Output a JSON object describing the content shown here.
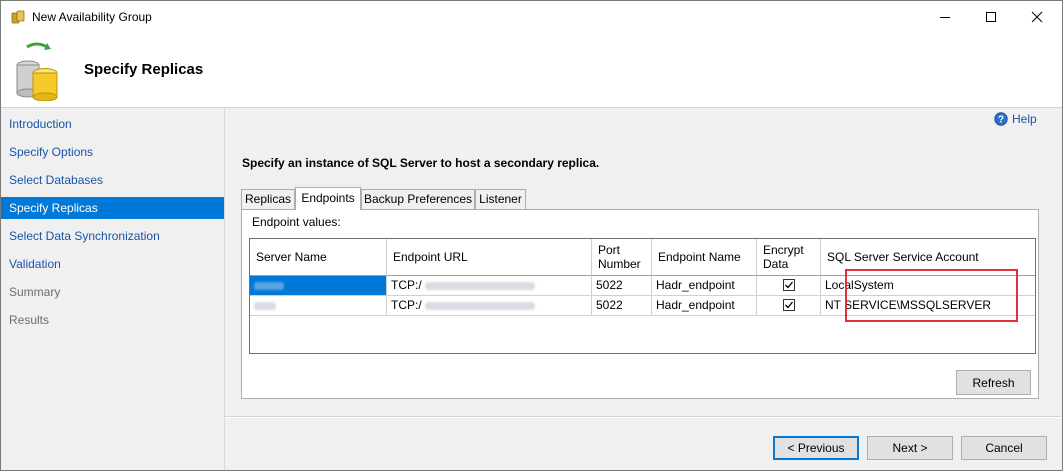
{
  "window": {
    "title": "New Availability Group",
    "icons": {
      "app": "database-group-icon",
      "minimize": "minimize-icon",
      "maximize": "maximize-icon",
      "close": "close-icon"
    }
  },
  "header": {
    "title": "Specify Replicas",
    "icon": "database-replica-icon"
  },
  "nav": {
    "items": [
      {
        "label": "Introduction",
        "state": "enabled"
      },
      {
        "label": "Specify Options",
        "state": "enabled"
      },
      {
        "label": "Select Databases",
        "state": "enabled"
      },
      {
        "label": "Specify Replicas",
        "state": "selected"
      },
      {
        "label": "Select Data Synchronization",
        "state": "enabled"
      },
      {
        "label": "Validation",
        "state": "enabled"
      },
      {
        "label": "Summary",
        "state": "disabled"
      },
      {
        "label": "Results",
        "state": "disabled"
      }
    ]
  },
  "help": {
    "label": "Help",
    "icon": "help-icon"
  },
  "instruction": "Specify an instance of SQL Server to host a secondary replica.",
  "tabs": [
    {
      "label": "Replicas",
      "active": false
    },
    {
      "label": "Endpoints",
      "active": true
    },
    {
      "label": "Backup Preferences",
      "active": false
    },
    {
      "label": "Listener",
      "active": false
    }
  ],
  "endpoints": {
    "caption": "Endpoint values:",
    "columns": [
      "Server Name",
      "Endpoint URL",
      "Port Number",
      "Endpoint Name",
      "Encrypt Data",
      "SQL Server Service Account"
    ],
    "rows": [
      {
        "server_name": "",
        "endpoint_url": "TCP:/",
        "port": "5022",
        "endpoint_name": "Hadr_endpoint",
        "encrypt": true,
        "service_account": "LocalSystem",
        "selected": true
      },
      {
        "server_name": "",
        "endpoint_url": "TCP:/",
        "port": "5022",
        "endpoint_name": "Hadr_endpoint",
        "encrypt": true,
        "service_account": "NT SERVICE\\MSSQLSERVER",
        "selected": false
      }
    ],
    "highlight_color": "#e0303a"
  },
  "buttons": {
    "refresh": "Refresh",
    "previous": "< Previous",
    "next": "Next >",
    "cancel": "Cancel"
  },
  "colors": {
    "accent": "#0078d7",
    "link": "#1a54a8",
    "panel_bg": "#f0f0f0"
  }
}
